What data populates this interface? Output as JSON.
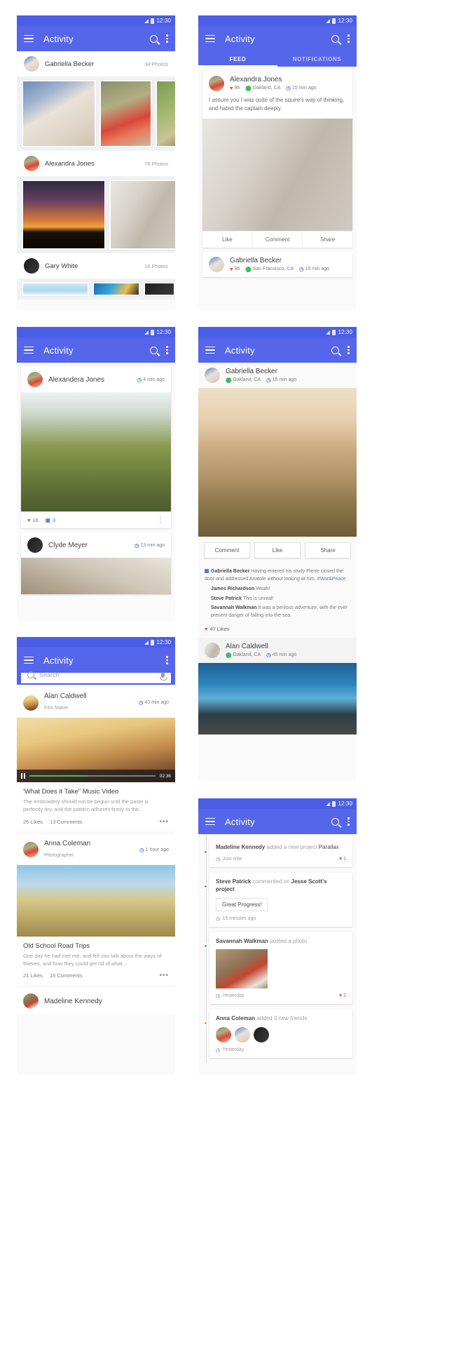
{
  "app": {
    "title": "Activity",
    "time": "12:30"
  },
  "tabs": {
    "feed": "FEED",
    "notifications": "NOTIFICATIONS"
  },
  "screen1": {
    "albums": [
      {
        "name": "Gabriella Becker",
        "count": "34 Photos"
      },
      {
        "name": "Alexandra Jones",
        "count": "76 Photos"
      },
      {
        "name": "Gary White",
        "count": "16 Photos"
      }
    ]
  },
  "screen2": {
    "posts": [
      {
        "name": "Alexandra Jones",
        "likes": "96",
        "location": "Oakland, CA",
        "time": "15 min ago",
        "text": "I assure you I was quite of the squire's way of thinking, and hated the captain deeply.",
        "actions": [
          "Like",
          "Comment",
          "Share"
        ]
      },
      {
        "name": "Gabriella Becker",
        "likes": "96",
        "location": "San Fransisco, CA",
        "time": "15 min ago"
      }
    ]
  },
  "screen3": {
    "posts": [
      {
        "name": "Alexandera Jones",
        "time": "4 min ago",
        "likes": "16",
        "comments": "3"
      },
      {
        "name": "Clyde Meyer",
        "time": "13 min ago"
      }
    ]
  },
  "screen4": {
    "post": {
      "name": "Gabriella Becker",
      "location": "Oakland, CA",
      "time": "15 min ago",
      "buttons": [
        "Comment",
        "Like",
        "Share"
      ],
      "comments": [
        {
          "author": "Gabriella Becker",
          "text": "Having entered his study Pierre closed the door and addressed Anatole without looking at him.",
          "tag": "#War&Peace",
          "featured": true
        },
        {
          "author": "James Richardson",
          "text": "Woah!"
        },
        {
          "author": "Steve Patrick",
          "text": "This is unreal!"
        },
        {
          "author": "Savannah Walkman",
          "text": "It was a perilous adventure, with the ever present danger of falling into the sea."
        }
      ],
      "likes_label": "47 Likes"
    },
    "next_post": {
      "name": "Alan Caldwell",
      "location": "Oakland, CA",
      "time": "45 min ago"
    }
  },
  "screen5": {
    "search_placeholder": "Search",
    "posts": [
      {
        "name": "Alan Caldwell",
        "role": "Film Maker",
        "time": "43 min ago",
        "video_time": "02:36",
        "title": "'What Does it Take\" Music Video",
        "desc": "The embroidery should not be begun until the paste is perfectly dry, and the pattern adheres firmly to the...",
        "likes": "26 Likes",
        "comments": "13 Comments"
      },
      {
        "name": "Anna Coleman",
        "role": "Photographer",
        "time": "1 hour ago",
        "title": "Old School Road Trips",
        "desc": "One day he had met me, and fell into talk about the ways of thieves, and how they could get rid of what...",
        "likes": "21 Likes",
        "comments": "15 Comments"
      },
      {
        "name": "Madeline Kennedy"
      }
    ]
  },
  "screen6": {
    "items": [
      {
        "author": "Madeline Kennedy",
        "action": "added a new project",
        "object": "Parallax",
        "time": "Just now",
        "count": "1",
        "dot": "#3ebd5a"
      },
      {
        "author": "Steve Patrick",
        "action": "commented on",
        "object": "Jesse Scott's project",
        "quote": "Great Progress!",
        "time": "15 minutes ago",
        "dot": "#3ebd5a"
      },
      {
        "author": "Savannah Walkman",
        "action": "posted a photo",
        "time": "Yesterday",
        "count": "2",
        "dot": "#3ebd5a"
      },
      {
        "author": "Anna Coleman",
        "action": "added 3 new friends",
        "time": "Yesterday",
        "dot": "#f0a32e"
      }
    ]
  },
  "icons": {
    "menu": "hamburger-icon",
    "search": "search-icon",
    "more": "overflow-menu-icon",
    "heart": "♥",
    "pin": "●",
    "clock": "◷",
    "dots": "•••"
  }
}
